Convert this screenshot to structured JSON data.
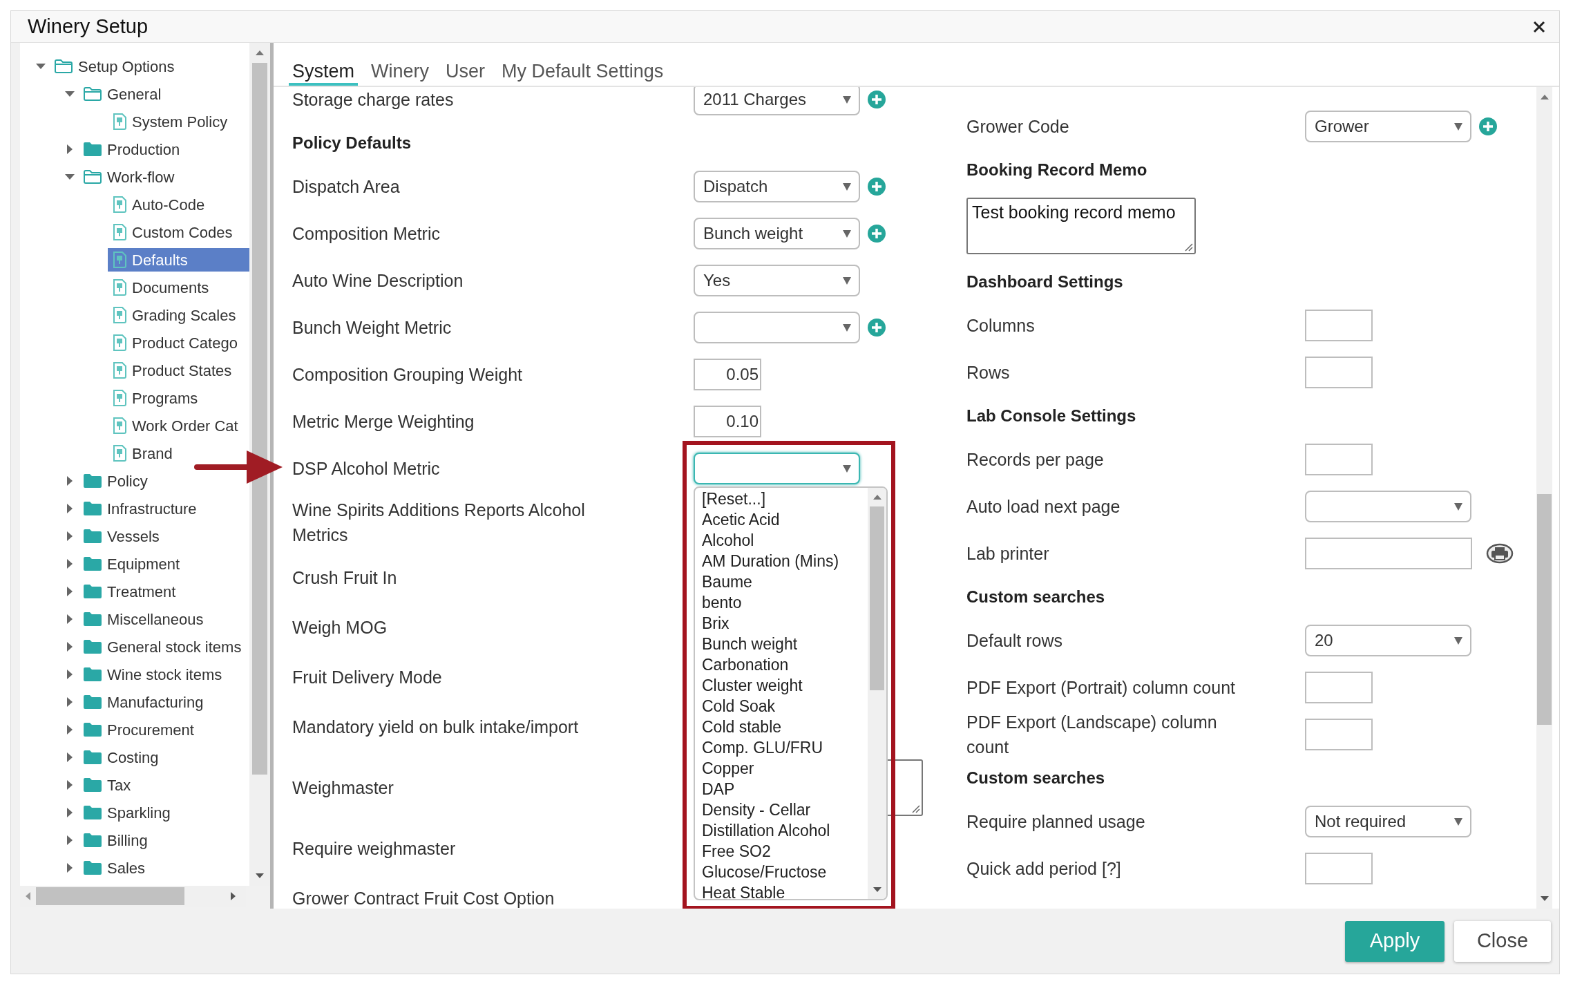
{
  "window": {
    "title": "Winery Setup"
  },
  "tree": [
    {
      "label": "Setup Options",
      "kind": "folder",
      "expanded": true,
      "selected": false,
      "children": [
        {
          "label": "General",
          "kind": "folder",
          "expanded": true,
          "selected": false,
          "children": [
            {
              "label": "System Policy",
              "kind": "page",
              "selected": false
            }
          ]
        },
        {
          "label": "Production",
          "kind": "folder",
          "expanded": false,
          "selected": false
        },
        {
          "label": "Work-flow",
          "kind": "folder",
          "expanded": true,
          "selected": false,
          "children": [
            {
              "label": "Auto-Code",
              "kind": "page",
              "selected": false
            },
            {
              "label": "Custom Codes",
              "kind": "page",
              "selected": false
            },
            {
              "label": "Defaults",
              "kind": "page",
              "selected": true
            },
            {
              "label": "Documents",
              "kind": "page",
              "selected": false
            },
            {
              "label": "Grading Scales",
              "kind": "page",
              "selected": false
            },
            {
              "label": "Product Catego",
              "kind": "page",
              "selected": false
            },
            {
              "label": "Product States",
              "kind": "page",
              "selected": false
            },
            {
              "label": "Programs",
              "kind": "page",
              "selected": false
            },
            {
              "label": "Work Order Cat",
              "kind": "page",
              "selected": false
            },
            {
              "label": "Brand",
              "kind": "page",
              "selected": false
            }
          ]
        },
        {
          "label": "Policy",
          "kind": "folder",
          "expanded": false,
          "selected": false
        },
        {
          "label": "Infrastructure",
          "kind": "folder",
          "expanded": false,
          "selected": false
        },
        {
          "label": "Vessels",
          "kind": "folder",
          "expanded": false,
          "selected": false
        },
        {
          "label": "Equipment",
          "kind": "folder",
          "expanded": false,
          "selected": false
        },
        {
          "label": "Treatment",
          "kind": "folder",
          "expanded": false,
          "selected": false
        },
        {
          "label": "Miscellaneous",
          "kind": "folder",
          "expanded": false,
          "selected": false
        },
        {
          "label": "General stock items",
          "kind": "folder",
          "expanded": false,
          "selected": false
        },
        {
          "label": "Wine stock items",
          "kind": "folder",
          "expanded": false,
          "selected": false
        },
        {
          "label": "Manufacturing",
          "kind": "folder",
          "expanded": false,
          "selected": false
        },
        {
          "label": "Procurement",
          "kind": "folder",
          "expanded": false,
          "selected": false
        },
        {
          "label": "Costing",
          "kind": "folder",
          "expanded": false,
          "selected": false
        },
        {
          "label": "Tax",
          "kind": "folder",
          "expanded": false,
          "selected": false
        },
        {
          "label": "Sparkling",
          "kind": "folder",
          "expanded": false,
          "selected": false
        },
        {
          "label": "Billing",
          "kind": "folder",
          "expanded": false,
          "selected": false
        },
        {
          "label": "Sales",
          "kind": "folder",
          "expanded": false,
          "selected": false
        }
      ]
    }
  ],
  "tabs": [
    {
      "label": "System",
      "selected": true
    },
    {
      "label": "Winery",
      "selected": false
    },
    {
      "label": "User",
      "selected": false
    },
    {
      "label": "My Default Settings",
      "selected": false
    }
  ],
  "left_fields": [
    {
      "kind": "select",
      "label": "Storage charge rates",
      "value": "2011 Charges",
      "add": true,
      "open": false
    },
    {
      "kind": "heading",
      "label": "Policy Defaults"
    },
    {
      "kind": "select",
      "label": "Dispatch Area",
      "value": "Dispatch",
      "add": true,
      "open": false
    },
    {
      "kind": "select",
      "label": "Composition Metric",
      "value": "Bunch weight",
      "add": true,
      "open": false
    },
    {
      "kind": "select",
      "label": "Auto Wine Description",
      "value": "Yes",
      "add": false,
      "open": false
    },
    {
      "kind": "select",
      "label": "Bunch Weight Metric",
      "add": true,
      "open": false
    },
    {
      "kind": "number",
      "label": "Composition Grouping Weight",
      "value": "0.05"
    },
    {
      "kind": "number",
      "label": "Metric Merge Weighting",
      "value": "0.10"
    },
    {
      "kind": "select",
      "label": "DSP Alcohol Metric",
      "add": false,
      "open": true,
      "options": [
        "[Reset...]",
        "Acetic Acid",
        "Alcohol",
        "AM Duration (Mins)",
        "Baume",
        "bento",
        "Brix",
        "Bunch weight",
        "Carbonation",
        "Cluster weight",
        "Cold Soak",
        "Cold stable",
        "Comp. GLU/FRU",
        "Copper",
        "DAP",
        "Density - Cellar",
        "Distillation Alcohol",
        "Free SO2",
        "Glucose/Fructose",
        "Heat Stable"
      ]
    },
    {
      "kind": "label",
      "label": "Wine Spirits Additions Reports Alcohol Metrics"
    },
    {
      "kind": "label",
      "label": "Crush Fruit In"
    },
    {
      "kind": "label",
      "label": "Weigh MOG"
    },
    {
      "kind": "label",
      "label": "Fruit Delivery Mode"
    },
    {
      "kind": "label",
      "label": "Mandatory yield on bulk intake/import"
    },
    {
      "kind": "textarea",
      "label": "Weighmaster"
    },
    {
      "kind": "label",
      "label": "Require weighmaster"
    },
    {
      "kind": "label",
      "label": "Grower Contract Fruit Cost Option"
    }
  ],
  "right_fields": [
    {
      "kind": "select",
      "label": "Grower Code",
      "value": "Grower",
      "add": true,
      "open": false
    },
    {
      "kind": "heading",
      "label": "Booking Record Memo"
    },
    {
      "kind": "textarea",
      "value": "Test booking record memo"
    },
    {
      "kind": "heading",
      "label": "Dashboard Settings"
    },
    {
      "kind": "number",
      "label": "Columns"
    },
    {
      "kind": "number",
      "label": "Rows"
    },
    {
      "kind": "heading",
      "label": "Lab Console Settings"
    },
    {
      "kind": "number",
      "label": "Records per page"
    },
    {
      "kind": "select",
      "label": "Auto load next page",
      "add": false,
      "open": false
    },
    {
      "kind": "printer",
      "label": "Lab printer"
    },
    {
      "kind": "heading",
      "label": "Custom searches"
    },
    {
      "kind": "select",
      "label": "Default rows",
      "value": "20",
      "add": false,
      "open": false
    },
    {
      "kind": "number",
      "label": "PDF Export (Portrait) column count"
    },
    {
      "kind": "number",
      "label": "PDF Export (Landscape) column count"
    },
    {
      "kind": "heading",
      "label": "Custom searches"
    },
    {
      "kind": "select",
      "label": "Require planned usage",
      "value": "Not required",
      "add": false,
      "open": false
    },
    {
      "kind": "number",
      "label": "Quick add period [?]"
    }
  ],
  "buttons": [
    {
      "label": "Apply",
      "kind": "primary"
    },
    {
      "label": "Close",
      "kind": "secondary"
    }
  ]
}
